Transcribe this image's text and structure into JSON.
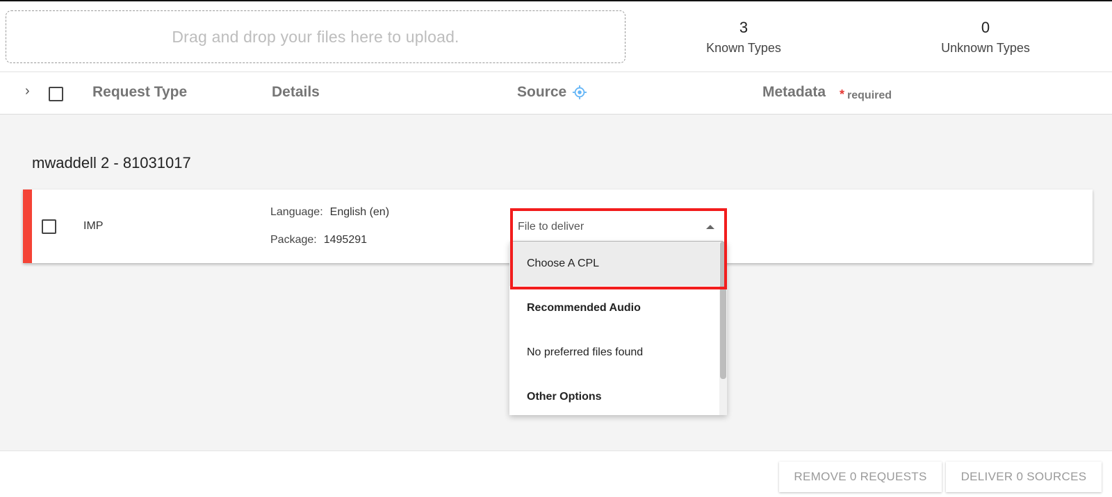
{
  "upload": {
    "dropzone_text": "Drag and drop your files here to upload."
  },
  "stats": {
    "known": {
      "count": "3",
      "label": "Known Types"
    },
    "unknown": {
      "count": "0",
      "label": "Unknown Types"
    }
  },
  "table_header": {
    "request_type": "Request Type",
    "details": "Details",
    "source": "Source",
    "metadata": "Metadata",
    "required_star": "*",
    "required_text": "required",
    "icons": {
      "expand": "chevron-right-icon",
      "source": "target-icon"
    }
  },
  "group": {
    "title": "mwaddell 2 - 81031017",
    "request": {
      "type": "IMP",
      "language_label": "Language:",
      "language_value": "English (en)",
      "package_label": "Package:",
      "package_value": "1495291",
      "status_color": "#f44336"
    }
  },
  "source_select": {
    "placeholder": "File to deliver",
    "options": [
      {
        "label": "Choose A CPL",
        "highlighted": true
      },
      {
        "label": "Recommended Audio",
        "header": true
      },
      {
        "label": "No preferred files found"
      },
      {
        "label": "Other Options",
        "header": true
      }
    ]
  },
  "footer": {
    "remove_label": "REMOVE 0 REQUESTS",
    "deliver_label": "DELIVER 0 SOURCES"
  },
  "colors": {
    "accent_red": "#f44336",
    "highlight_box": "#f21d1d",
    "target_icon": "#64b5f6"
  }
}
